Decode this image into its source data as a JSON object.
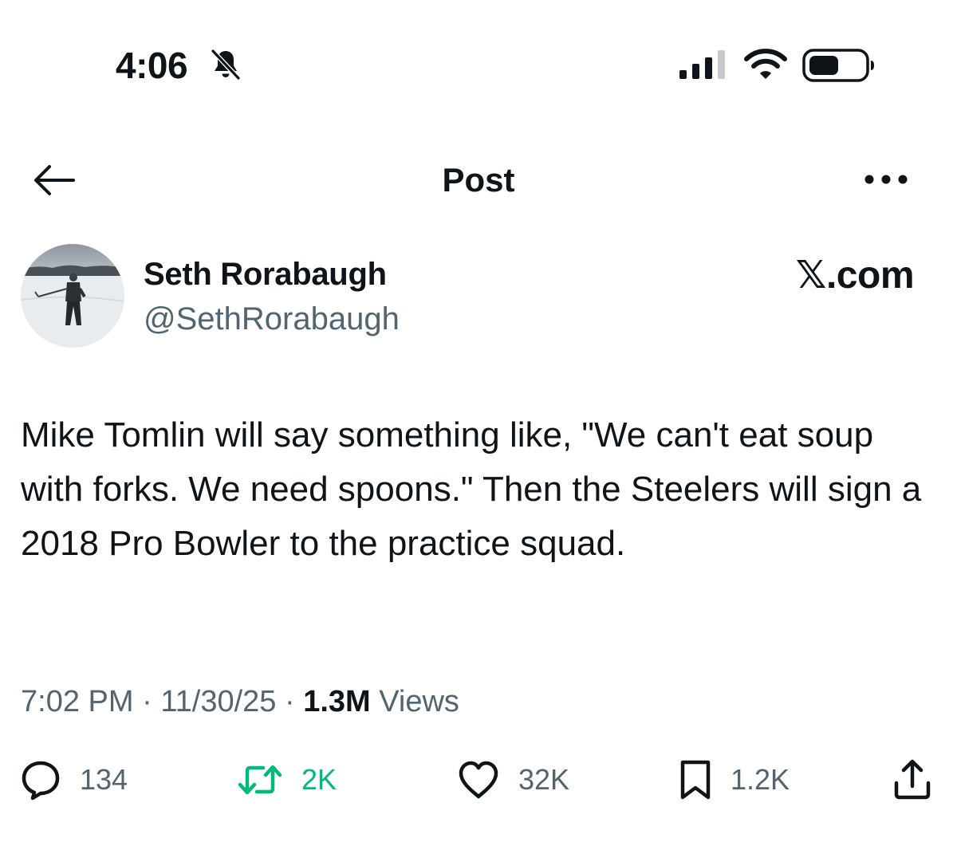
{
  "status_bar": {
    "time": "4:06",
    "icons": [
      "bell-slash-icon",
      "cellular-signal-icon",
      "wifi-icon",
      "battery-icon"
    ]
  },
  "nav": {
    "title": "Post",
    "back_icon": "arrow-left-icon",
    "more_icon": "more-horizontal-icon"
  },
  "author": {
    "name": "Seth Rorabaugh",
    "handle": "@SethRorabaugh"
  },
  "watermark": "𝕏.com",
  "tweet": {
    "text": "Mike Tomlin will say something like, \"We can't eat soup with forks. We need spoons.\" Then the Steelers will sign a 2018 Pro Bowler to the practice squad."
  },
  "meta": {
    "time": "7:02 PM",
    "separator": "·",
    "date": "11/30/25",
    "views_count": "1.3M",
    "views_label": "Views"
  },
  "actions": {
    "reply": {
      "icon": "reply-icon",
      "count": "134"
    },
    "repost": {
      "icon": "repost-icon",
      "count": "2K"
    },
    "like": {
      "icon": "heart-icon",
      "count": "32K"
    },
    "bookmark": {
      "icon": "bookmark-icon",
      "count": "1.2K"
    },
    "share": {
      "icon": "share-icon"
    }
  },
  "colors": {
    "text": "#0f1419",
    "secondary": "#536471",
    "repost_green": "#00ba7c",
    "background": "#ffffff"
  }
}
